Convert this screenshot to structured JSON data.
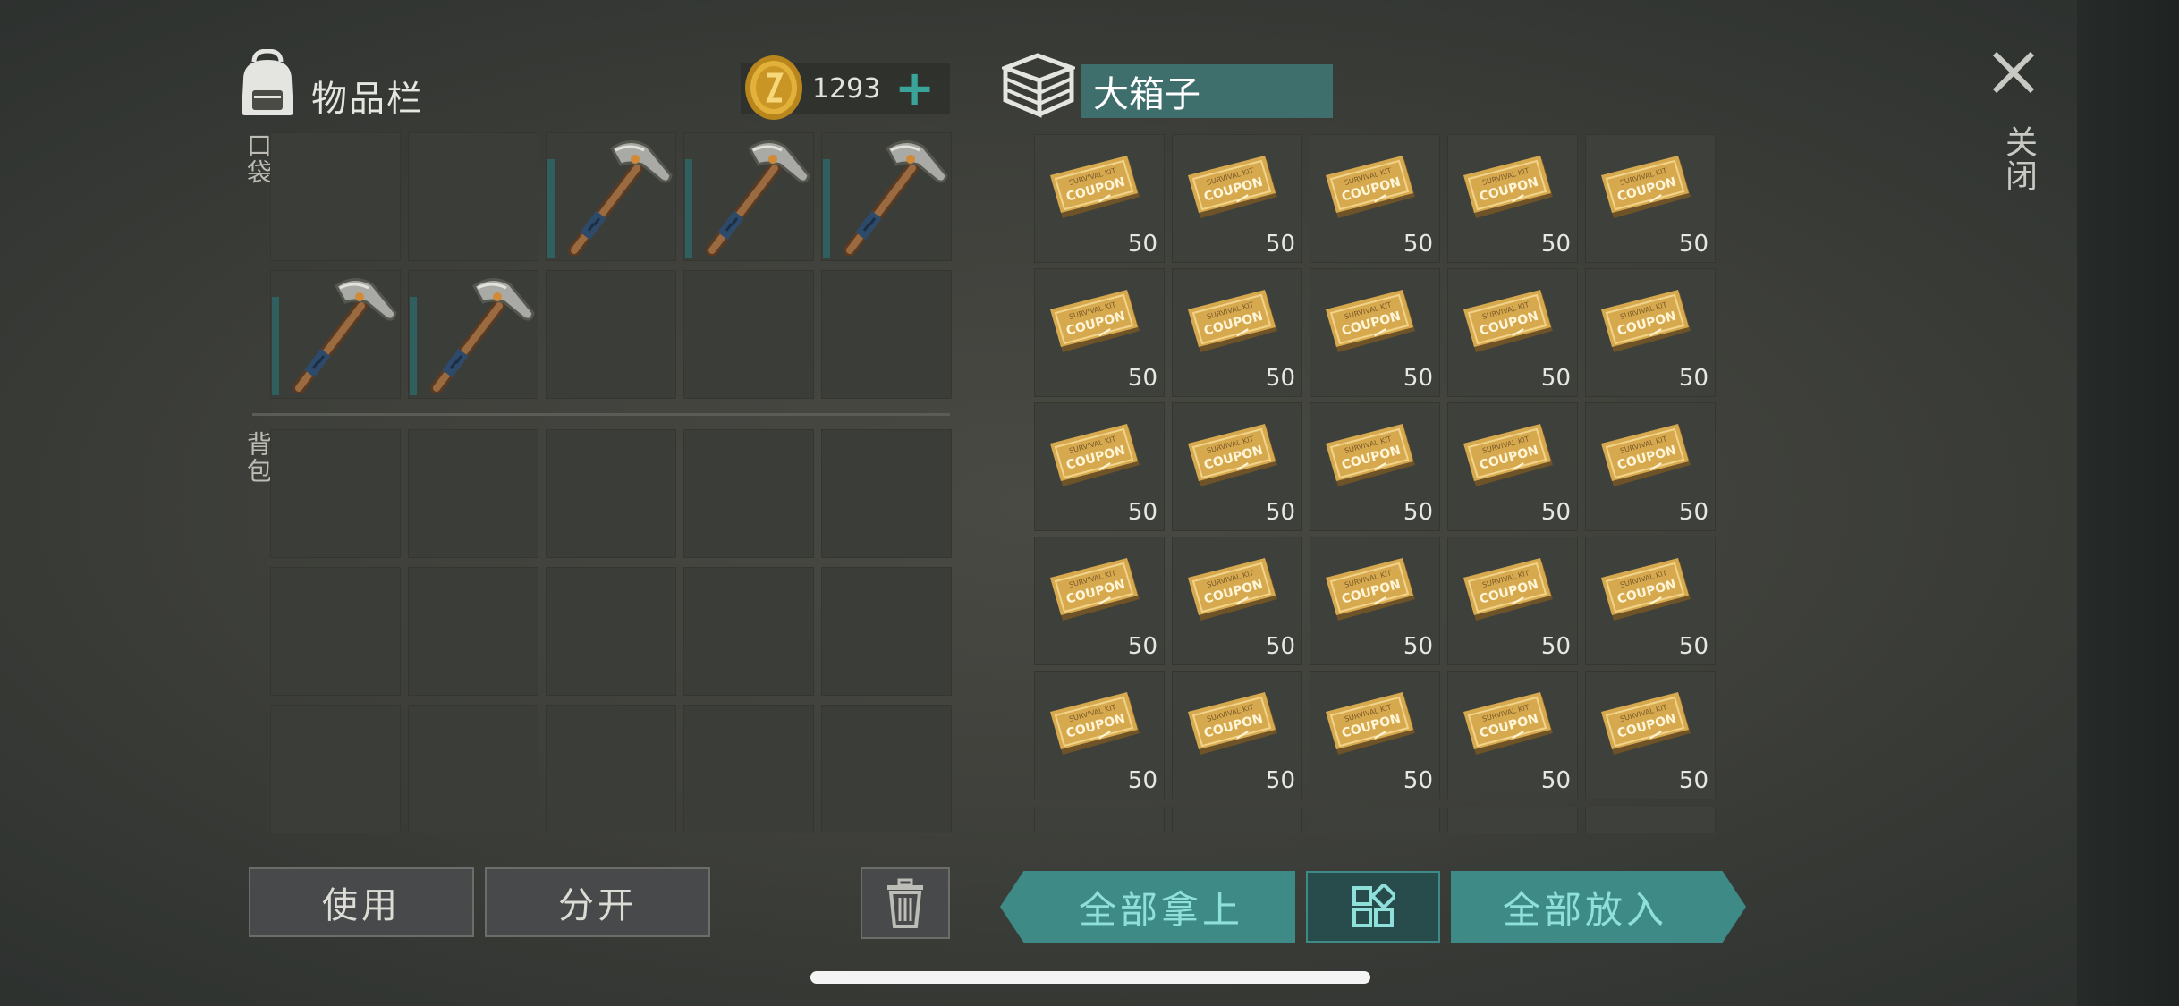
{
  "inventory": {
    "title": "物品栏",
    "currency": {
      "amount": "1293",
      "plus": "+"
    },
    "pocket_label": "口袋",
    "backpack_label": "背包",
    "pocket_slots": [
      "pickaxe",
      "pickaxe",
      "pickaxe",
      "pickaxe",
      "pickaxe",
      "",
      "",
      "",
      ""
    ],
    "buttons": {
      "use": "使用",
      "split": "分开"
    }
  },
  "container": {
    "title": "大箱子",
    "item": "survival-kit-coupon",
    "coupon_text": "COUPON",
    "coupon_subtext": "SURVIVAL KIT",
    "qty": "50",
    "buttons": {
      "take_all": "全部拿上",
      "put_all": "全部放入"
    }
  },
  "close": {
    "label": "关闭"
  },
  "colors": {
    "accent": "#3d8a87",
    "title_bar": "#3f6f6c",
    "plus": "#3aa49a"
  }
}
